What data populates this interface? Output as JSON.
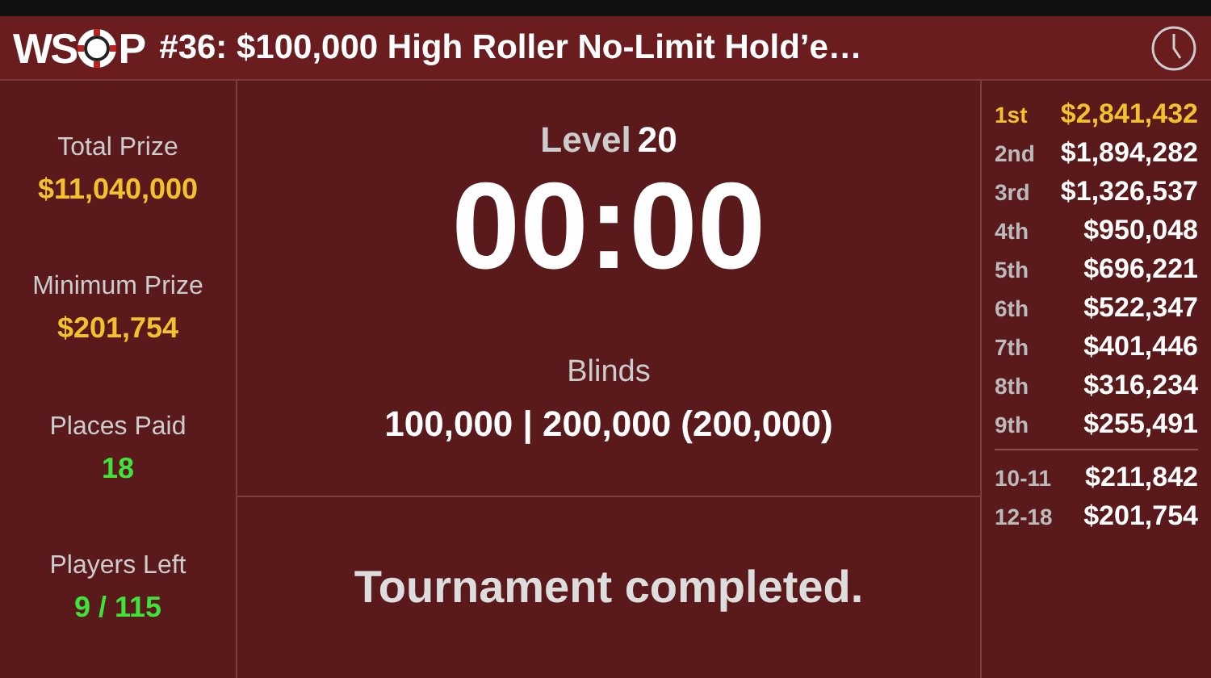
{
  "header": {
    "logo_left": "WS",
    "logo_right": "P",
    "title": "#36: $100,000 High Roller No-Limit Hold’e…"
  },
  "stats": [
    {
      "label": "Total Prize",
      "value": "$11,040,000",
      "color": "#f2c12e"
    },
    {
      "label": "Minimum Prize",
      "value": "$201,754",
      "color": "#f2c12e"
    },
    {
      "label": "Places Paid",
      "value": "18",
      "color": "#3ee43a"
    },
    {
      "label": "Players Left",
      "value": "9 / 115",
      "color": "#3ee43a"
    }
  ],
  "level": {
    "label": "Level",
    "number": "20",
    "clock": "00:00"
  },
  "blinds": {
    "label": "Blinds",
    "value": "100,000 | 200,000 (200,000)"
  },
  "status": "Tournament completed.",
  "payout_groups": [
    [
      {
        "place": "1st",
        "amount": "$2,841,432",
        "color": "#f2c12e"
      },
      {
        "place": "2nd",
        "amount": "$1,894,282",
        "color": "#ffffff"
      },
      {
        "place": "3rd",
        "amount": "$1,326,537",
        "color": "#ffffff"
      },
      {
        "place": "4th",
        "amount": "$950,048",
        "color": "#ffffff"
      },
      {
        "place": "5th",
        "amount": "$696,221",
        "color": "#ffffff"
      },
      {
        "place": "6th",
        "amount": "$522,347",
        "color": "#ffffff"
      },
      {
        "place": "7th",
        "amount": "$401,446",
        "color": "#ffffff"
      },
      {
        "place": "8th",
        "amount": "$316,234",
        "color": "#ffffff"
      },
      {
        "place": "9th",
        "amount": "$255,491",
        "color": "#ffffff"
      }
    ],
    [
      {
        "place": "10-11",
        "amount": "$211,842",
        "color": "#ffffff"
      },
      {
        "place": "12-18",
        "amount": "$201,754",
        "color": "#ffffff"
      }
    ]
  ]
}
